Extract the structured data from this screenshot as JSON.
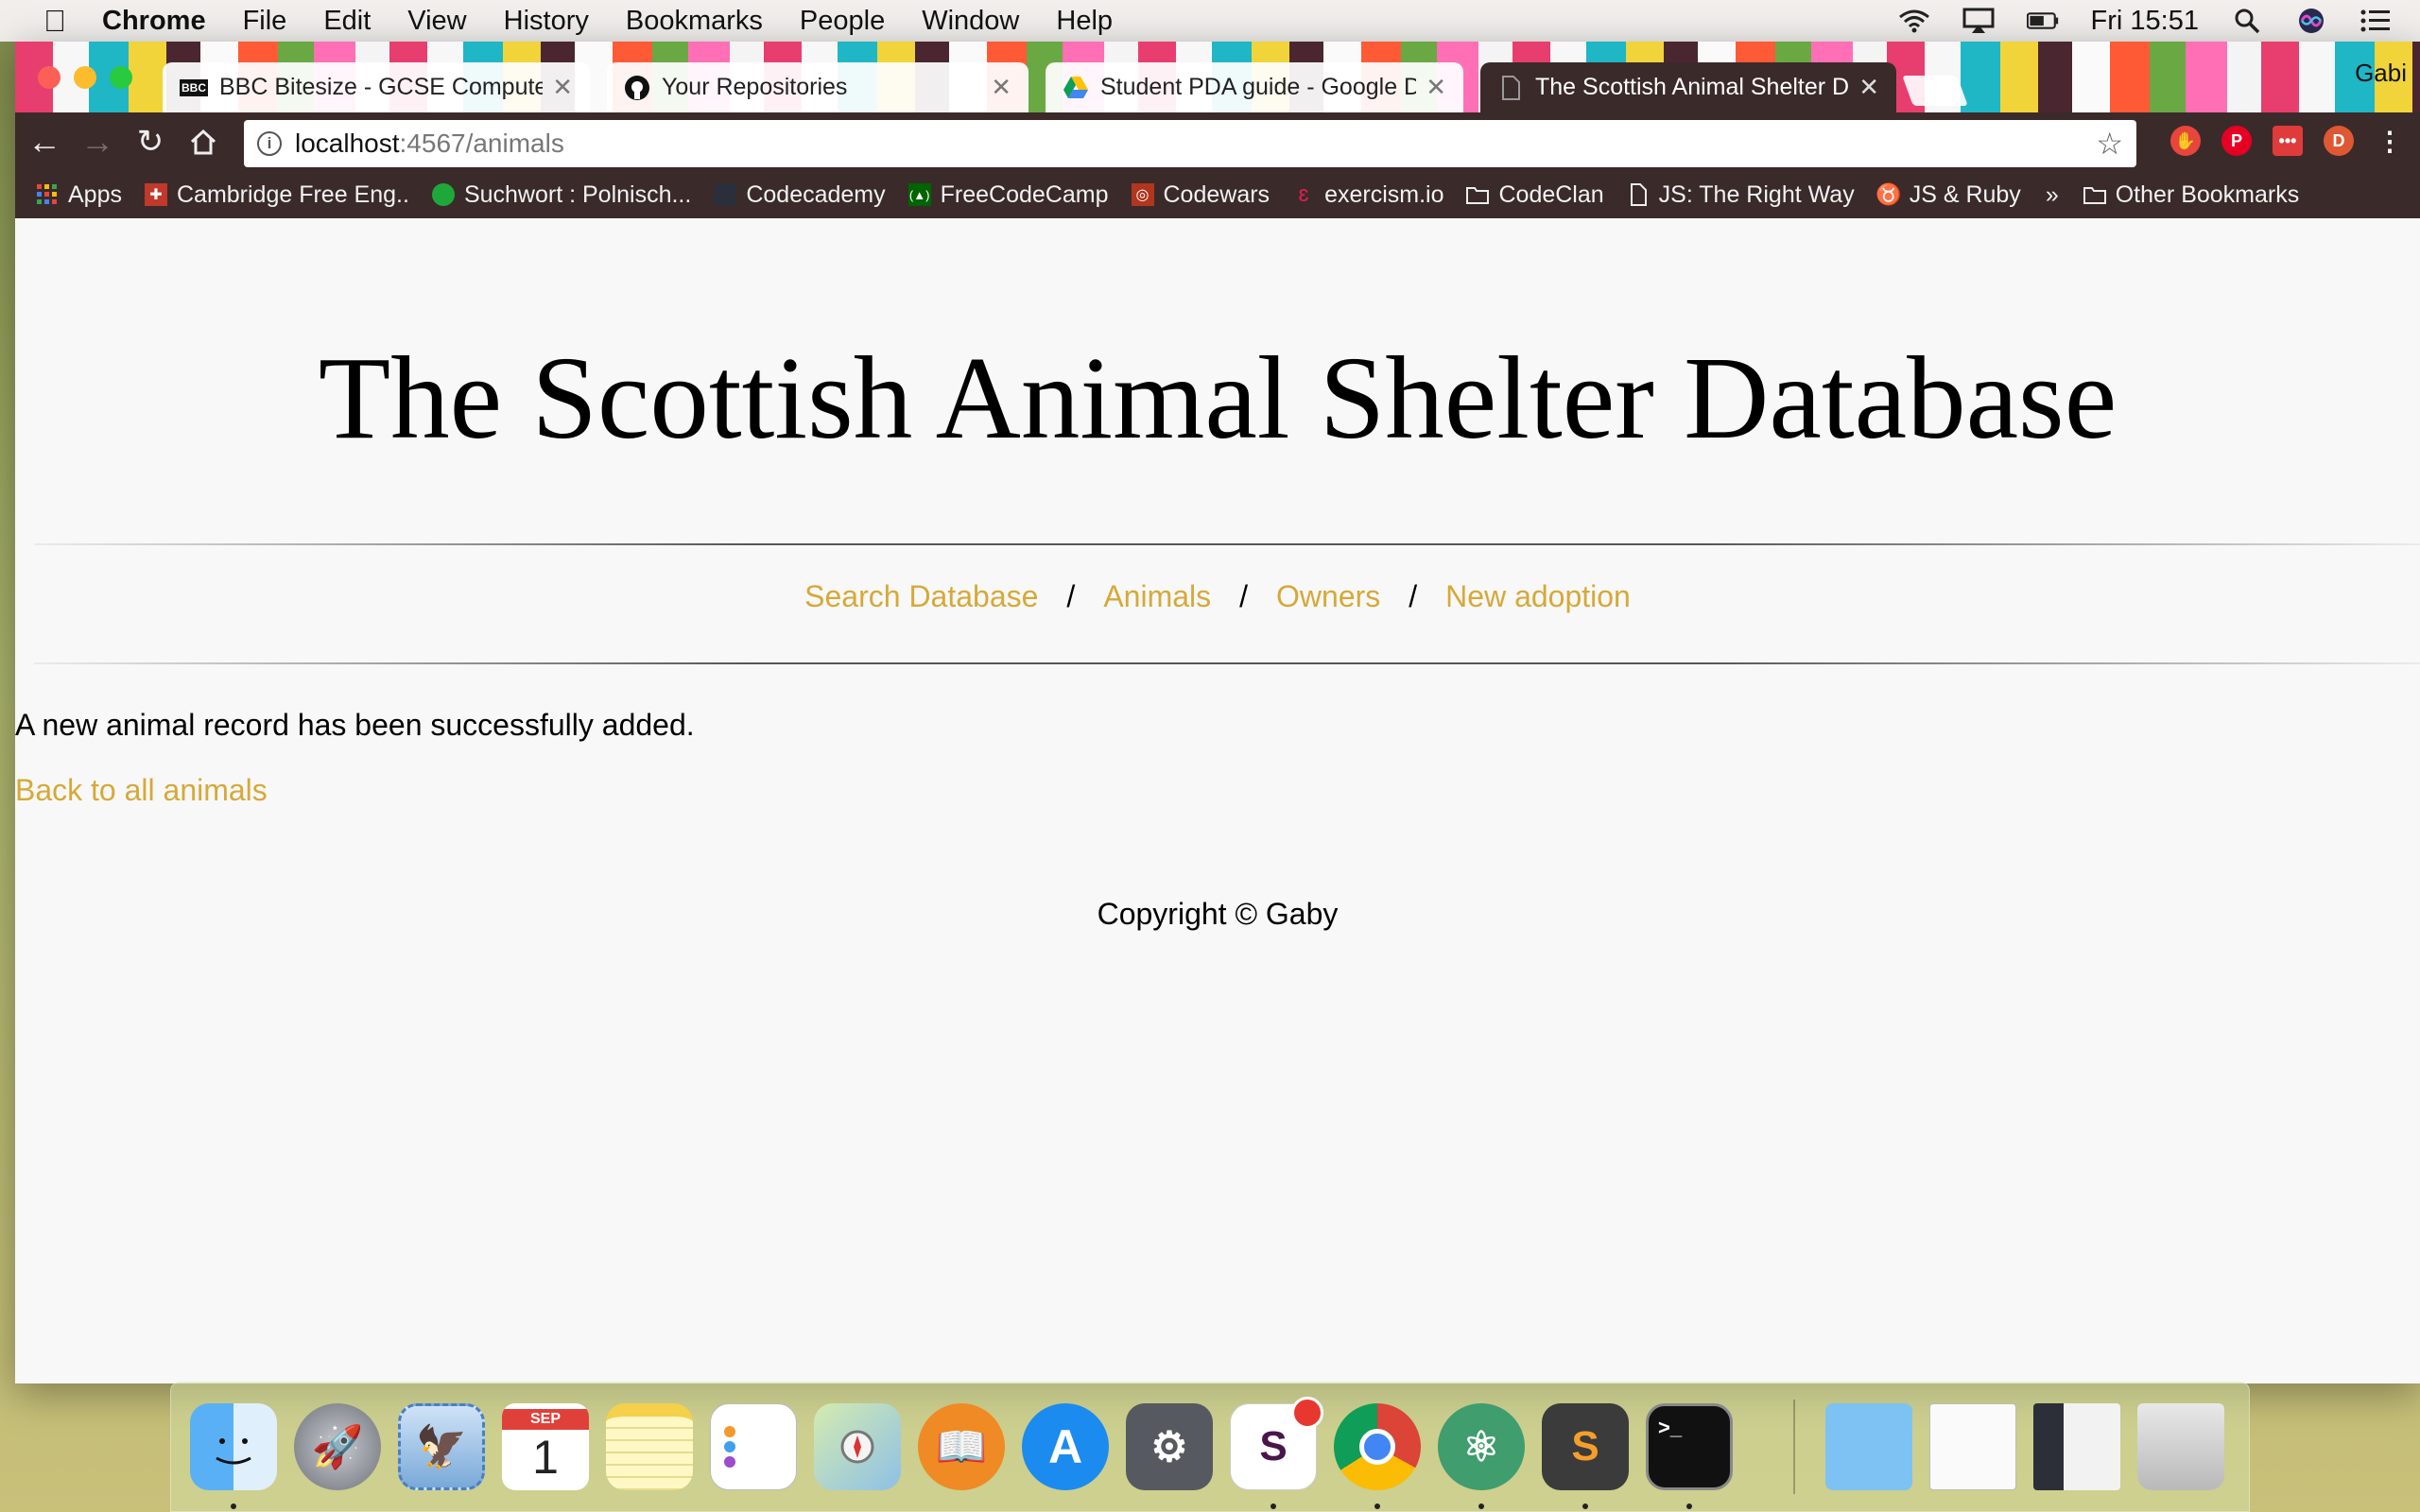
{
  "menubar": {
    "app_name": "Chrome",
    "items": [
      "File",
      "Edit",
      "View",
      "History",
      "Bookmarks",
      "People",
      "Window",
      "Help"
    ],
    "clock": "Fri 15:51",
    "icons": [
      "wifi-icon",
      "airplay-icon",
      "battery-icon",
      "spotlight-icon",
      "siri-icon",
      "notification-center-icon"
    ]
  },
  "browser": {
    "profile": "Gabi",
    "tabs": [
      {
        "title": "BBC Bitesize - GCSE Computer Science",
        "favicon": "bbc-icon"
      },
      {
        "title": "Your Repositories",
        "favicon": "github-icon"
      },
      {
        "title": "Student PDA guide - Google Drive",
        "favicon": "google-drive-icon"
      },
      {
        "title": "The Scottish Animal Shelter Database",
        "favicon": "page-icon",
        "active": true
      }
    ],
    "url_host": "localhost",
    "url_rest": ":4567/animals",
    "bookmarks": [
      {
        "label": "Apps",
        "icon": "apps-grid-icon"
      },
      {
        "label": "Cambridge Free Eng..",
        "icon": "cambridge-icon"
      },
      {
        "label": "Suchwort : Polnisch...",
        "icon": "leaf-icon"
      },
      {
        "label": "Codecademy",
        "icon": "codecademy-icon"
      },
      {
        "label": "FreeCodeCamp",
        "icon": "freecodecamp-icon"
      },
      {
        "label": "Codewars",
        "icon": "codewars-icon"
      },
      {
        "label": "exercism.io",
        "icon": "exercism-icon"
      },
      {
        "label": "CodeClan",
        "icon": "folder-icon"
      },
      {
        "label": "JS: The Right Way",
        "icon": "page-icon"
      },
      {
        "label": "JS & Ruby",
        "icon": "cow-icon"
      }
    ],
    "bookmarks_overflow": "»",
    "other_bookmarks": "Other Bookmarks"
  },
  "page": {
    "title": "The Scottish Animal Shelter Database",
    "nav": [
      "Search Database",
      "Animals",
      "Owners",
      "New adoption"
    ],
    "nav_separator": "/",
    "message": "A new animal record has been successfully added.",
    "back_link": "Back to all animals",
    "footer": "Copyright © Gaby",
    "link_color": "#d6a938"
  },
  "dock": {
    "calendar_month": "SEP",
    "calendar_day": "1",
    "terminal_prompt": ">_",
    "apps": [
      "finder-icon",
      "launchpad-icon",
      "mail-icon",
      "calendar-icon",
      "notes-icon",
      "reminders-icon",
      "maps-icon",
      "ibooks-icon",
      "app-store-icon",
      "system-preferences-icon",
      "slack-icon",
      "chrome-icon",
      "atom-icon",
      "sublime-text-icon",
      "terminal-icon",
      "downloads-folder-icon",
      "document-thumbnail-icon",
      "document-thumbnail-icon",
      "trash-icon"
    ]
  }
}
